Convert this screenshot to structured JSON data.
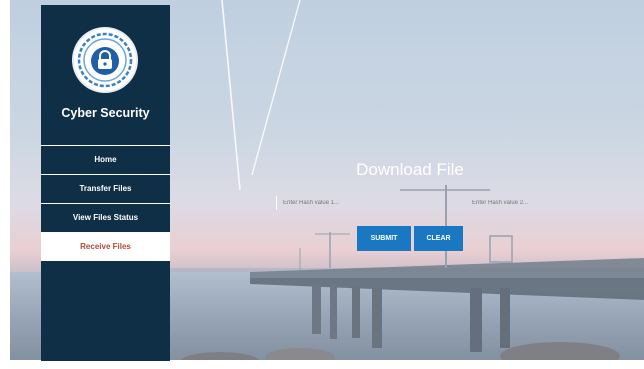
{
  "app": {
    "brand": "Cyber Security"
  },
  "sidebar": {
    "items": [
      {
        "label": "Home"
      },
      {
        "label": "Transfer Files"
      },
      {
        "label": "View Files Status"
      },
      {
        "label": "Receive Files"
      }
    ],
    "active": "Receive Files"
  },
  "main": {
    "title": "Download File",
    "hash1_placeholder": "Enter Hash value 1...",
    "hash2_placeholder": "Enter Hash value 2...",
    "submit_label": "SUBMIT",
    "clear_label": "CLEAR"
  },
  "colors": {
    "sidebar": "#0f2f46",
    "button": "#1a78c2",
    "active_text": "#b04a3a"
  },
  "icons": {
    "logo": "padlock-shield-icon"
  }
}
